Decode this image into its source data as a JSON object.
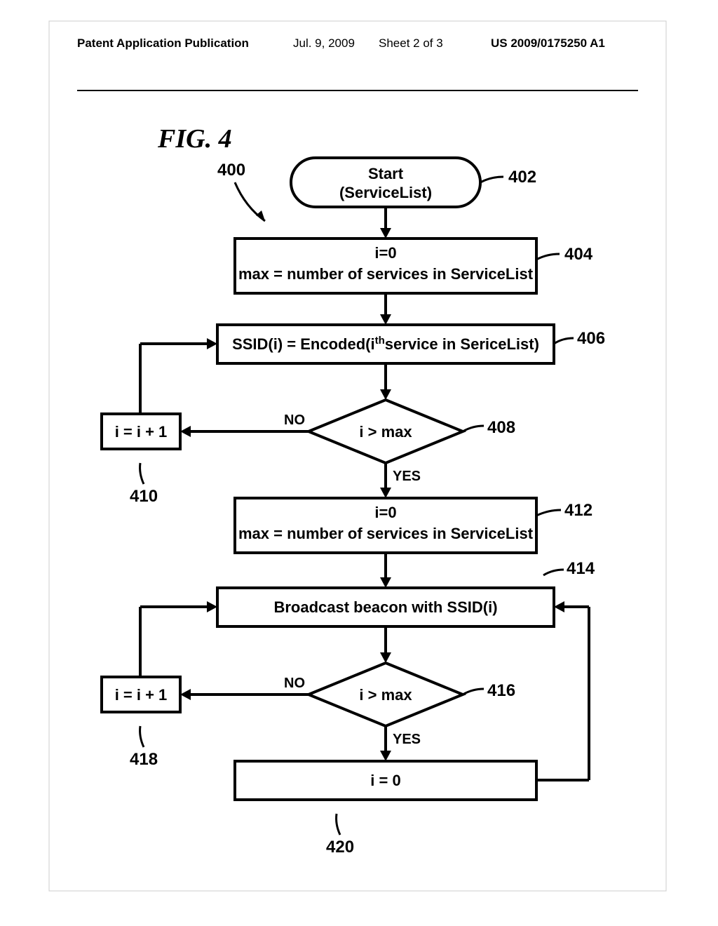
{
  "header": {
    "pub_type": "Patent Application Publication",
    "date": "Jul. 9, 2009",
    "sheet": "Sheet 2 of 3",
    "pub_no": "US 2009/0175250 A1"
  },
  "figure": {
    "title": "FIG. 4",
    "ref_arrow": "400",
    "blocks": {
      "start_line1": "Start",
      "start_line2": "(ServiceList)",
      "b404_line1": "i=0",
      "b404_line2": "max = number of services in ServiceList",
      "b406_pre": "SSID(i) = Encoded(i",
      "b406_sup": "th",
      "b406_post": "service in SericeList)",
      "d408": "i > max",
      "b410": "i = i + 1",
      "b412_line1": "i=0",
      "b412_line2": "max = number of services in ServiceList",
      "b414": "Broadcast beacon with SSID(i)",
      "d416": "i > max",
      "b418": "i = i + 1",
      "b420": "i = 0"
    },
    "labels": {
      "r402": "402",
      "r404": "404",
      "r406": "406",
      "r408": "408",
      "r410": "410",
      "r412": "412",
      "r414": "414",
      "r416": "416",
      "r418": "418",
      "r420": "420",
      "no1": "NO",
      "yes1": "YES",
      "no2": "NO",
      "yes2": "YES"
    }
  }
}
